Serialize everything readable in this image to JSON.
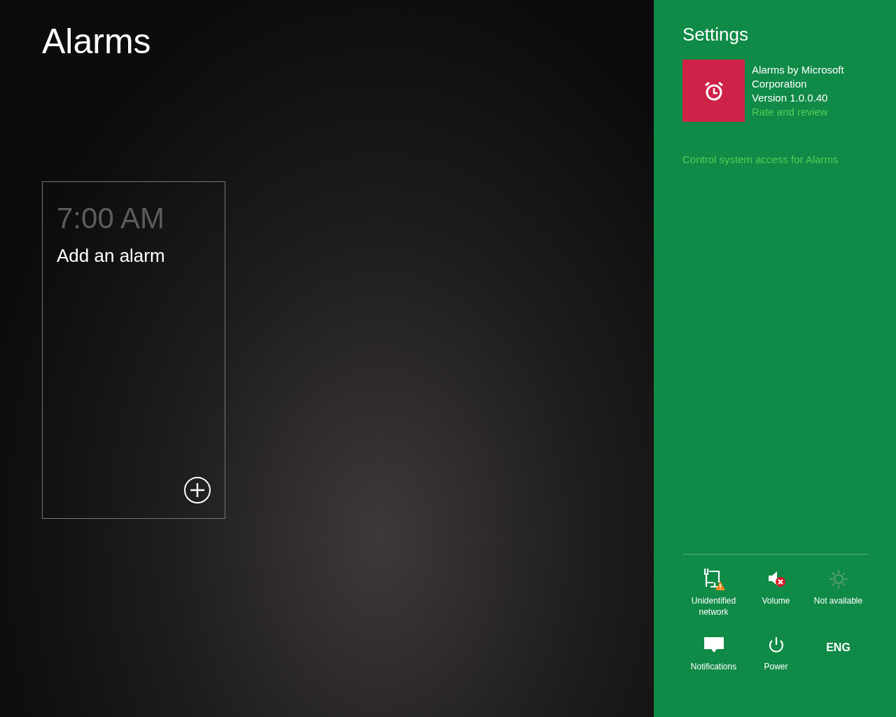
{
  "app": {
    "title": "Alarms"
  },
  "alarm_card": {
    "time": "7:00 AM",
    "label": "Add an alarm"
  },
  "settings": {
    "title": "Settings",
    "app_info": {
      "lines": [
        "Alarms by Microsoft",
        "Corporation",
        "Version 1.0.0.40"
      ],
      "link": "Rate and review"
    },
    "permissions_link": "Control system access for Alarms",
    "quick_settings": [
      {
        "kind": "network",
        "label": "Unidentified network",
        "disabled": false
      },
      {
        "kind": "volume",
        "label": "Volume",
        "disabled": false
      },
      {
        "kind": "brightness",
        "label": "Not available",
        "disabled": true
      },
      {
        "kind": "notifications",
        "label": "Notifications",
        "disabled": false
      },
      {
        "kind": "power",
        "label": "Power",
        "disabled": false
      },
      {
        "kind": "language",
        "label": "ENG",
        "disabled": false
      }
    ]
  }
}
